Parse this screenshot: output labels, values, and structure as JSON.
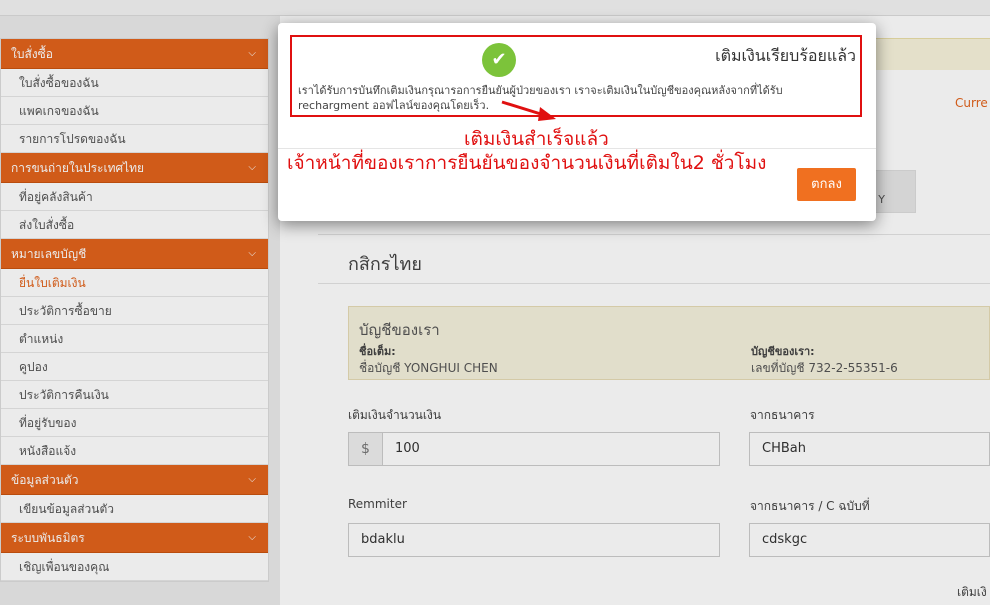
{
  "sidebar": {
    "sections": [
      {
        "title": "ใบสั่งซื้อ",
        "items": [
          "ใบสั่งซื้อของฉัน",
          "แพคเกจของฉัน",
          "รายการโปรดของฉัน"
        ]
      },
      {
        "title": "การขนถ่ายในประเทศไทย",
        "items": [
          "ที่อยู่คลังสินค้า",
          "ส่งใบสั่งซื้อ"
        ]
      },
      {
        "title": "หมายเลขบัญชี",
        "items": [
          "ยื่นใบเติมเงิน",
          "ประวัติการซื้อขาย",
          "ตำแหน่ง",
          "คูปอง",
          "ประวัติการคืนเงิน",
          "ที่อยู่รับของ",
          "หนังสือแจ้ง"
        ]
      },
      {
        "title": "ข้อมูลส่วนตัว",
        "items": [
          "เขียนข้อมูลส่วนตัว"
        ]
      },
      {
        "title": "ระบบพันธมิตร",
        "items": [
          "เชิญเพื่อนของคุณ"
        ]
      }
    ],
    "active_item": "ยื่นใบเติมเงิน"
  },
  "main": {
    "currency_link": "Curre",
    "bank_title": "กสิกรไทย",
    "account": {
      "heading": "บัญชีของเรา",
      "name_label": "ชื่อเต็ม:",
      "name_value": "ชื่อบัญชี YONGHUI CHEN",
      "number_label": "บัญชีของเรา:",
      "number_value": "เลขที่บัญชี 732-2-55351-6"
    },
    "form": {
      "amount_label": "เติมเงินจำนวนเงิน",
      "currency_symbol": "$",
      "amount_value": "100",
      "from_bank_label": "จากธนาคาร",
      "from_bank_value": "CHBah",
      "remitter_label": "Remmiter",
      "remitter_value": "bdaklu",
      "bank_no_label": "จากธนาคาร / C ฉบับที่",
      "bank_no_value": "cdskgc",
      "bottom_label": "เติมเงิ"
    }
  },
  "modal": {
    "title": "เติมเงินเรียบร้อยแล้ว",
    "message": "เราได้รับการบันทึกเติมเงินกรุณารอการยืนยันผู้ป่วยของเรา เราจะเติมเงินในบัญชีของคุณหลังจากที่ได้รับ rechargment ออฟไลน์ของคุณโดยเร็ว.",
    "annotation_1": "เติมเงินสำเร็จแล้ว",
    "annotation_2": "เจ้าหน้าที่ของเราการยืนยันของจำนวนเงินที่เติมใน2 ชั่วโมง",
    "ok_label": "ตกลง",
    "accent": "#f07020",
    "annotation_color": "#e01010"
  }
}
